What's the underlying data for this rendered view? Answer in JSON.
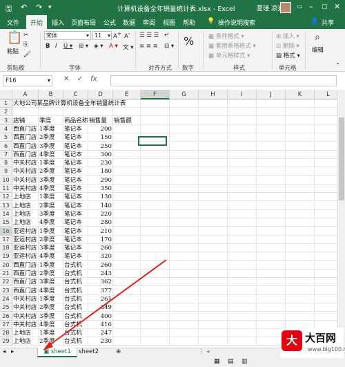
{
  "title_bar": {
    "doc_title": "计算机设备全年销量统计表.xlsx  -  Excel",
    "user": "夏瑾 凉安"
  },
  "tabs": [
    "文件",
    "开始",
    "插入",
    "页面布局",
    "公式",
    "数据",
    "审阅",
    "视图",
    "帮助",
    "操作说明搜索",
    "共享"
  ],
  "ribbon": {
    "paste": "粘贴",
    "font_name": "宋体",
    "font_size": "11",
    "conditional_format": "条件格式",
    "table_format": "套用表格格式",
    "cell_style": "单元格样式",
    "insert": "插入",
    "delete": "删除",
    "format": "格式",
    "edit": "编辑",
    "groups": [
      "剪贴板",
      "字体",
      "对齐方式",
      "数字",
      "样式",
      "单元格"
    ]
  },
  "formula_bar": {
    "name_box": "F16",
    "fx": "fx"
  },
  "columns": [
    "A",
    "B",
    "C",
    "D",
    "E",
    "F",
    "G",
    "H",
    "I",
    "J",
    "K",
    "L"
  ],
  "rows": [
    [
      "大地公司某品牌计算机设备全年销量统计表",
      "",
      "",
      ""
    ],
    [
      "",
      "",
      "",
      ""
    ],
    [
      "店铺",
      "季度",
      "商品名称",
      "销售量",
      "销售额"
    ],
    [
      "西直门店",
      "1季度",
      "笔记本",
      "200"
    ],
    [
      "西直门店",
      "2季度",
      "笔记本",
      "150"
    ],
    [
      "西直门店",
      "3季度",
      "笔记本",
      "250"
    ],
    [
      "西直门店",
      "4季度",
      "笔记本",
      "300"
    ],
    [
      "中关村店",
      "1季度",
      "笔记本",
      "230"
    ],
    [
      "中关村店",
      "2季度",
      "笔记本",
      "180"
    ],
    [
      "中关村店",
      "3季度",
      "笔记本",
      "290"
    ],
    [
      "中关村店",
      "4季度",
      "笔记本",
      "350"
    ],
    [
      "上地店",
      "1季度",
      "笔记本",
      "130"
    ],
    [
      "上地店",
      "2季度",
      "笔记本",
      "140"
    ],
    [
      "上地店",
      "3季度",
      "笔记本",
      "220"
    ],
    [
      "上地店",
      "4季度",
      "笔记本",
      "280"
    ],
    [
      "亚运村店",
      "1季度",
      "笔记本",
      "210"
    ],
    [
      "亚运村店",
      "2季度",
      "笔记本",
      "170"
    ],
    [
      "亚运村店",
      "3季度",
      "笔记本",
      "260"
    ],
    [
      "亚运村店",
      "4季度",
      "笔记本",
      "320"
    ],
    [
      "西直门店",
      "1季度",
      "台式机",
      "260"
    ],
    [
      "西直门店",
      "2季度",
      "台式机",
      "243"
    ],
    [
      "西直门店",
      "3季度",
      "台式机",
      "362"
    ],
    [
      "西直门店",
      "4季度",
      "台式机",
      "377"
    ],
    [
      "中关村店",
      "1季度",
      "台式机",
      "261"
    ],
    [
      "中关村店",
      "2季度",
      "台式机",
      "349"
    ],
    [
      "中关村店",
      "3季度",
      "台式机",
      "400"
    ],
    [
      "中关村店",
      "4季度",
      "台式机",
      "416"
    ],
    [
      "上地店",
      "1季度",
      "台式机",
      "247"
    ],
    [
      "上地店",
      "2季度",
      "台式机",
      "230"
    ]
  ],
  "sheets": [
    "sheet1",
    "sheet2"
  ],
  "active_sheet": "sheet1",
  "watermark": {
    "name": "大百网",
    "url": "www.big100.net",
    "icon": "大"
  },
  "colors": {
    "excel_green": "#217346",
    "arrow": "#e0201b"
  }
}
